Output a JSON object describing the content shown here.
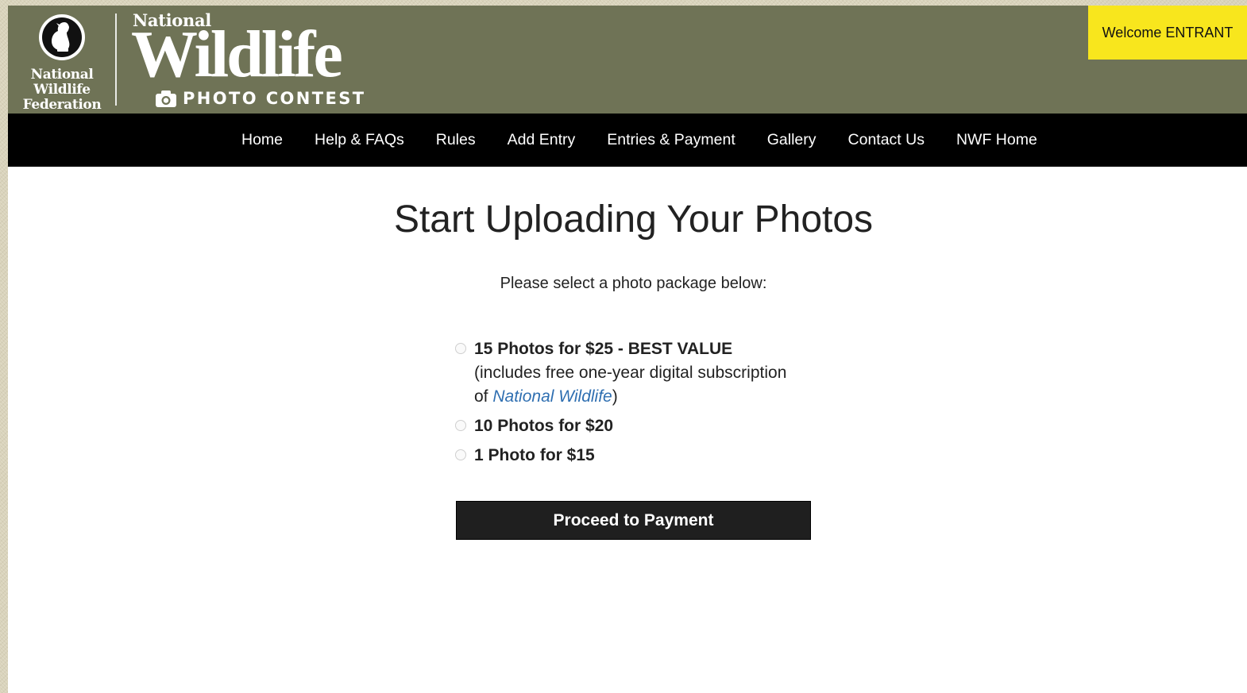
{
  "header": {
    "org_logo_lines": [
      "National",
      "Wildlife",
      "Federation"
    ],
    "wordmark_top": "National",
    "wordmark_main": "Wildlife",
    "wordmark_sub": "PHOTO CONTEST",
    "icons": {
      "org_emblem": "nwf-emblem-icon",
      "camera": "camera-icon"
    },
    "colors": {
      "header_bg": "#6f7356",
      "welcome_bg": "#f8e61d",
      "nav_bg": "#000000"
    }
  },
  "welcome": {
    "label": "Welcome ENTRANT"
  },
  "nav": {
    "items": [
      {
        "label": "Home"
      },
      {
        "label": "Help & FAQs"
      },
      {
        "label": "Rules"
      },
      {
        "label": "Add Entry"
      },
      {
        "label": "Entries & Payment"
      },
      {
        "label": "Gallery"
      },
      {
        "label": "Contact Us"
      },
      {
        "label": "NWF Home"
      }
    ]
  },
  "main": {
    "title": "Start Uploading Your Photos",
    "subtitle": "Please select a photo package below:",
    "packages": [
      {
        "label": "15 Photos for $25 - BEST VALUE",
        "desc_prefix": "(includes free one-year digital subscription of ",
        "desc_link": "National Wildlife",
        "desc_suffix": ")",
        "selected": false
      },
      {
        "label": "10 Photos for $20",
        "selected": false
      },
      {
        "label": "1 Photo for $15",
        "selected": false
      }
    ],
    "proceed_label": "Proceed to Payment",
    "link_color": "#2f6fb1"
  }
}
